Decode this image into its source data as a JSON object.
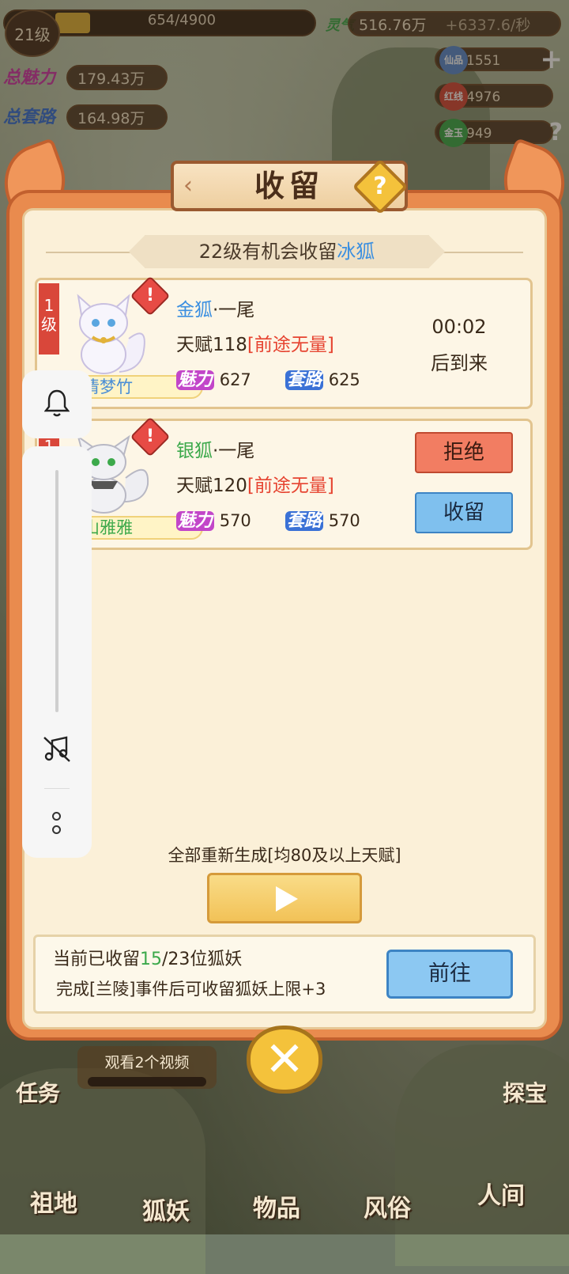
{
  "hud": {
    "level": "21级",
    "exp": "654/4900",
    "exp_fraction": 0.133,
    "charm_total_label": "总魅力",
    "charm_total": "179.43万",
    "trick_total_label": "总套路",
    "trick_total": "164.98万",
    "spirit_label": "灵气",
    "spirit": "516.76万",
    "spirit_rate": "+6337.6/秒",
    "resources": [
      {
        "icon": "immortal-product-icon",
        "label": "仙品",
        "value": "1551"
      },
      {
        "icon": "red-thread-icon",
        "label": "红线",
        "value": "4976"
      },
      {
        "icon": "gold-jade-icon",
        "label": "金玉",
        "value": "949"
      }
    ]
  },
  "modal": {
    "title": "收留",
    "subtitle_prefix": "22级有机会收留",
    "subtitle_highlight": "冰狐",
    "cards": [
      {
        "level": "1级",
        "species": "金狐",
        "species_color": "#3b8fe0",
        "tail": "·一尾",
        "talent_prefix": "天赋118",
        "talent_tag": "[前途无量]",
        "name": "清梦竹",
        "charm_label": "魅力",
        "charm": "627",
        "trick_label": "套路",
        "trick": "625",
        "timer": "00:02",
        "timer_suffix": "后到来"
      },
      {
        "level": "1级",
        "species": "银狐",
        "species_color": "#3ca94b",
        "tail": "·一尾",
        "talent_prefix": "天赋120",
        "talent_tag": "[前途无量]",
        "name": "山雅雅",
        "charm_label": "魅力",
        "charm": "570",
        "trick_label": "套路",
        "trick": "570",
        "reject_label": "拒绝",
        "accept_label": "收留"
      }
    ],
    "regen_text": "全部重新生成[均80及以上天赋]",
    "footer": {
      "line1_prefix": "当前已收留",
      "line1_count": "15",
      "line1_suffix": "/23位狐妖",
      "line2": "完成[兰陵]事件后可收留狐妖上限+3",
      "go_label": "前往"
    }
  },
  "bottom": {
    "video_label": "观看2个视频",
    "task_label": "任务",
    "treasure_label": "探宝",
    "nav": [
      "祖地",
      "狐妖",
      "物品",
      "风俗",
      "人间"
    ]
  }
}
